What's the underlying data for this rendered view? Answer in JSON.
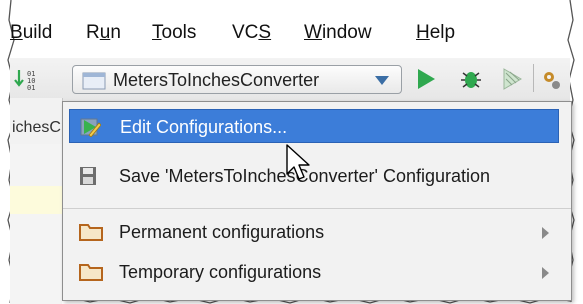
{
  "menubar": {
    "items": [
      {
        "label": "Build",
        "mnemonic": "B",
        "rest": "uild"
      },
      {
        "label": "Run",
        "pre": "R",
        "mnemonic": "u",
        "rest": "n"
      },
      {
        "label": "Tools",
        "mnemonic": "T",
        "rest": "ools"
      },
      {
        "label": "VCS",
        "pre": "VC",
        "mnemonic": "S",
        "rest": ""
      },
      {
        "label": "Window",
        "mnemonic": "W",
        "rest": "indow"
      },
      {
        "label": "Help",
        "mnemonic": "H",
        "rest": "elp"
      }
    ]
  },
  "toolbar": {
    "run_config_label": "MetersToInchesConverter",
    "icons": [
      "sort-icon",
      "run-icon",
      "debug-icon",
      "coverage-icon",
      "settings-icon"
    ]
  },
  "editor": {
    "tab_partial_text": "ichesC"
  },
  "popup": {
    "items": [
      {
        "label": "Edit Configurations...",
        "icon": "edit-config-icon",
        "selected": true
      },
      {
        "label": "Save 'MetersToInchesConverter' Configuration",
        "icon": "save-icon"
      },
      {
        "label": "Permanent configurations",
        "icon": "folder-icon",
        "submenu": true
      },
      {
        "label": "Temporary configurations",
        "icon": "folder-icon",
        "submenu": true
      }
    ]
  },
  "colors": {
    "selection": "#3c7dd9",
    "run_green": "#2fa84f",
    "folder": "#b5651d",
    "highlight_line": "#fdfbdc"
  }
}
